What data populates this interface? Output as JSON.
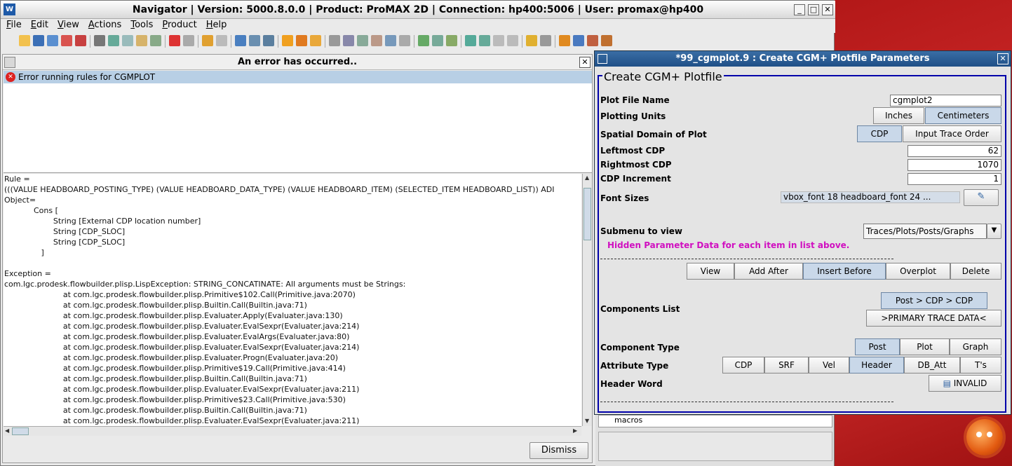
{
  "window": {
    "title": "Navigator | Version: 5000.8.0.0 | Product: ProMAX 2D | Connection: hp400:5006 | User: promax@hp400"
  },
  "menu": [
    "File",
    "Edit",
    "View",
    "Actions",
    "Tools",
    "Product",
    "Help"
  ],
  "error_dialog": {
    "title": "An error has occurred..",
    "error_item": "Error running rules for CGMPLOT",
    "detail_lines": [
      "Rule =",
      "(((VALUE HEADBOARD_POSTING_TYPE) (VALUE HEADBOARD_DATA_TYPE) (VALUE HEADBOARD_ITEM) (SELECTED_ITEM HEADBOARD_LIST)) ADI",
      "Object=",
      "            Cons [",
      "                    String [External CDP location number]",
      "                    String [CDP_SLOC]",
      "                    String [CDP_SLOC]",
      "               ]",
      "",
      "Exception =",
      "com.lgc.prodesk.flowbuilder.plisp.LispException: STRING_CONCATINATE: All arguments must be Strings:",
      "                        at com.lgc.prodesk.flowbuilder.plisp.Primitive$102.Call(Primitive.java:2070)",
      "                        at com.lgc.prodesk.flowbuilder.plisp.Builtin.Call(Builtin.java:71)",
      "                        at com.lgc.prodesk.flowbuilder.plisp.Evaluater.Apply(Evaluater.java:130)",
      "                        at com.lgc.prodesk.flowbuilder.plisp.Evaluater.EvalSexpr(Evaluater.java:214)",
      "                        at com.lgc.prodesk.flowbuilder.plisp.Evaluater.EvalArgs(Evaluater.java:80)",
      "                        at com.lgc.prodesk.flowbuilder.plisp.Evaluater.EvalSexpr(Evaluater.java:214)",
      "                        at com.lgc.prodesk.flowbuilder.plisp.Evaluater.Progn(Evaluater.java:20)",
      "                        at com.lgc.prodesk.flowbuilder.plisp.Primitive$19.Call(Primitive.java:414)",
      "                        at com.lgc.prodesk.flowbuilder.plisp.Builtin.Call(Builtin.java:71)",
      "                        at com.lgc.prodesk.flowbuilder.plisp.Evaluater.EvalSexpr(Evaluater.java:211)",
      "                        at com.lgc.prodesk.flowbuilder.plisp.Primitive$23.Call(Primitive.java:530)",
      "                        at com.lgc.prodesk.flowbuilder.plisp.Builtin.Call(Builtin.java:71)",
      "                        at com.lgc.prodesk.flowbuilder.plisp.Evaluater.EvalSexpr(Evaluater.java:211)"
    ],
    "dismiss": "Dismiss"
  },
  "params": {
    "title": "*99_cgmplot.9 : Create CGM+ Plotfile Parameters",
    "section": "Create CGM+ Plotfile",
    "plot_file_name": {
      "label": "Plot File Name",
      "value": "cgmplot2"
    },
    "plotting_units": {
      "label": "Plotting Units",
      "options": [
        "Inches",
        "Centimeters"
      ]
    },
    "spatial_domain": {
      "label": "Spatial Domain of Plot",
      "options": [
        "CDP",
        "Input Trace Order"
      ]
    },
    "leftmost": {
      "label": "Leftmost CDP",
      "value": "62"
    },
    "rightmost": {
      "label": "Rightmost CDP",
      "value": "1070"
    },
    "increment": {
      "label": "CDP Increment",
      "value": "1"
    },
    "font_sizes": {
      "label": "Font Sizes",
      "value": "vbox_font  18 headboard_font 24 ..."
    },
    "submenu": {
      "label": "Submenu to view",
      "value": "Traces/Plots/Posts/Graphs"
    },
    "hidden_hint": "Hidden Parameter Data for each item in list above.",
    "list_buttons": [
      "View",
      "Add After",
      "Insert Before",
      "Overplot",
      "Delete"
    ],
    "components": {
      "label": "Components List",
      "items": [
        "Post  > CDP > CDP",
        ">PRIMARY TRACE DATA<"
      ]
    },
    "component_type": {
      "label": "Component Type",
      "options": [
        "Post",
        "Plot",
        "Graph"
      ]
    },
    "attribute_type": {
      "label": "Attribute Type",
      "options": [
        "CDP",
        "SRF",
        "Vel",
        "Header",
        "DB_Att",
        "T's"
      ]
    },
    "header_word": {
      "label": "Header Word",
      "value": "INVALID"
    }
  },
  "background_combo": "macros"
}
